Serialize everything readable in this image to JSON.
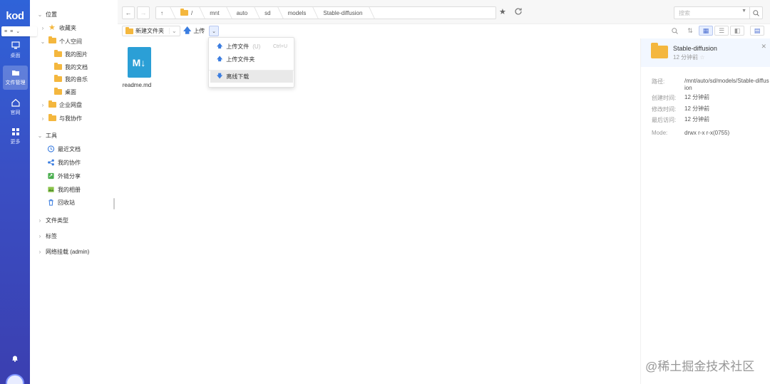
{
  "rail": {
    "logo": "kod",
    "items": [
      {
        "label": "桌面",
        "icon": "desktop-icon"
      },
      {
        "label": "文件管理",
        "icon": "folder-icon"
      },
      {
        "label": "官网",
        "icon": "home-icon"
      },
      {
        "label": "更多",
        "icon": "grid-icon"
      }
    ]
  },
  "tree": {
    "location_label": "位置",
    "favorites": "收藏夹",
    "personal_space": "个人空间",
    "my_pictures": "我的图片",
    "my_documents": "我的文档",
    "my_music": "我的音乐",
    "desktop": "桌面",
    "enterprise_disk": "企业网盘",
    "collab_with_me": "与我协作",
    "tools_label": "工具",
    "recent_docs": "最近文档",
    "my_collab": "我的协作",
    "link_share": "外链分享",
    "my_album": "我的相册",
    "recycle_bin": "回收站",
    "file_types": "文件类型",
    "tags": "标签",
    "network_mount": "网络挂载 (admin)"
  },
  "toolbar": {
    "breadcrumbs": [
      "/",
      "mnt",
      "auto",
      "sd",
      "models",
      "Stable-diffusion"
    ],
    "search_placeholder": "搜索",
    "new_folder": "新建文件夹",
    "upload": "上传"
  },
  "menu": {
    "upload_file": "上传文件",
    "upload_file_hint": "(U)",
    "upload_file_shortcut": "Ctrl+U",
    "upload_folder": "上传文件夹",
    "offline_download": "离线下载"
  },
  "files": [
    {
      "name": "readme.md",
      "icon_text": "M↓"
    }
  ],
  "info": {
    "name": "Stable-diffusion",
    "subtitle": "12 分钟前",
    "path_label": "路径:",
    "path_value": "/mnt/auto/sd/models/Stable-diffusion",
    "created_label": "创建时间:",
    "created_value": "12 分钟前",
    "modified_label": "修改时间:",
    "modified_value": "12 分钟前",
    "accessed_label": "最后访问:",
    "accessed_value": "12 分钟前",
    "mode_label": "Mode:",
    "mode_value": "drwx r-x r-x(0755)"
  },
  "watermark": "@稀土掘金技术社区",
  "colors": {
    "accent": "#2f63d8",
    "folder": "#f4b73e",
    "md_file": "#2b9fd6"
  }
}
